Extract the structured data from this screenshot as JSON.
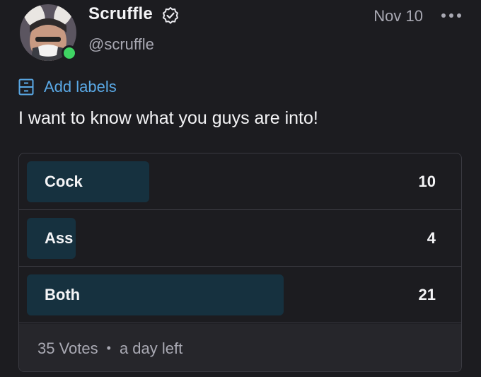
{
  "author": {
    "name": "Scruffle",
    "handle": "@scruffle",
    "verified": true,
    "online": true
  },
  "date": "Nov 10",
  "labels_action": "Add labels",
  "post_text": "I want to know what you guys are into!",
  "poll": {
    "options": [
      {
        "label": "Cock",
        "votes": "10",
        "share": 0.2857
      },
      {
        "label": "Ass",
        "votes": "4",
        "share": 0.1143
      },
      {
        "label": "Both",
        "votes": "21",
        "share": 0.6
      }
    ],
    "total_votes": "35 Votes",
    "separator": "•",
    "time_left": "a day left"
  },
  "colors": {
    "accent": "#5aa9e6",
    "bar": "#16313f",
    "online": "#3fd463",
    "background": "#1c1c20"
  },
  "icons": [
    "verified-badge-icon",
    "more-options-icon",
    "labels-icon"
  ]
}
